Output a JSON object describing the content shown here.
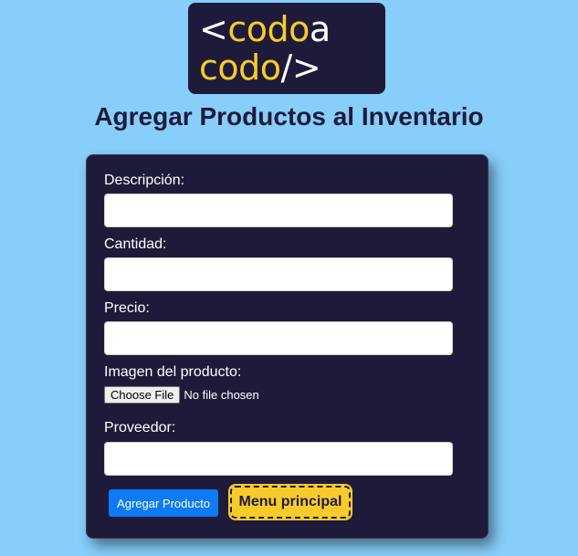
{
  "logo": {
    "line1_lt": "<",
    "line1_codo": "codo",
    "line1_a": "a",
    "line2_codo": "codo",
    "line2_slash": "/>"
  },
  "page": {
    "title": "Agregar Productos al Inventario"
  },
  "form": {
    "descripcion_label": "Descripción:",
    "descripcion_value": "",
    "cantidad_label": "Cantidad:",
    "cantidad_value": "",
    "precio_label": "Precio:",
    "precio_value": "",
    "imagen_label": "Imagen del producto:",
    "file_button_label": "Choose File",
    "file_status": "No file chosen",
    "proveedor_label": "Proveedor:",
    "proveedor_value": "",
    "submit_label": "Agregar Producto",
    "menu_label": "Menu principal"
  },
  "colors": {
    "background": "#87cefa",
    "card": "#1e1b3a",
    "accent_yellow": "#f9cb2a",
    "button_blue": "#0d7bf2"
  }
}
